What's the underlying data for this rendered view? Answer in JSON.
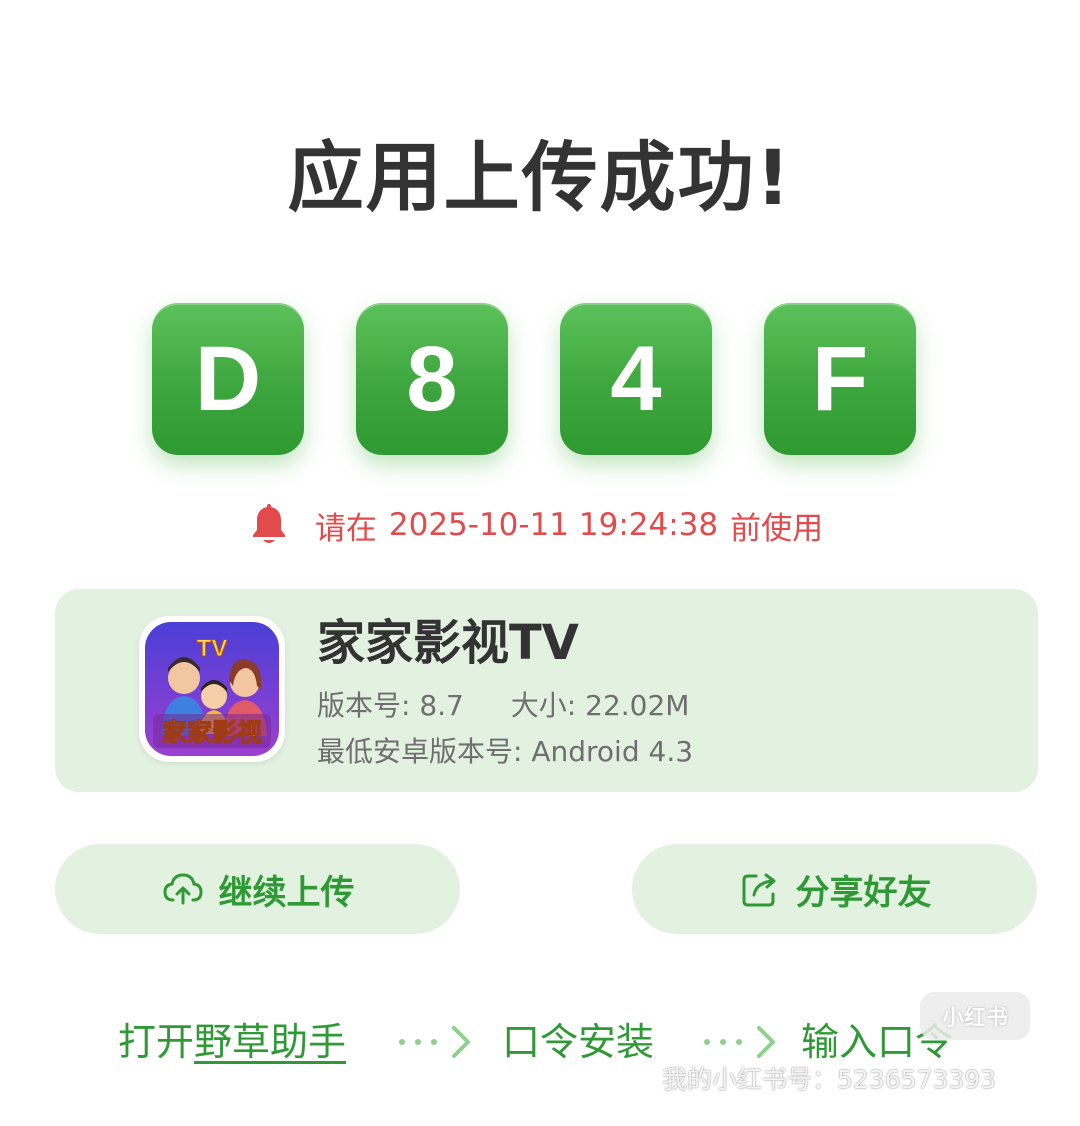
{
  "title": "应用上传成功!",
  "code": [
    "D",
    "8",
    "4",
    "F"
  ],
  "expire": {
    "prefix": "请在",
    "datetime": "2025-10-11 19:24:38",
    "suffix": "前使用"
  },
  "app": {
    "icon_text_top": "TV",
    "icon_text_bottom": "家家影视",
    "name": "家家影视TV",
    "version_label": "版本号:",
    "version": "8.7",
    "size_label": "大小:",
    "size": "22.02M",
    "min_android_label": "最低安卓版本号:",
    "min_android": "Android 4.3"
  },
  "buttons": {
    "continue_upload": "继续上传",
    "share_friends": "分享好友"
  },
  "steps": {
    "step1_prefix": "打开",
    "step1_highlight": "野草助手",
    "step2": "口令安装",
    "step3": "输入口令"
  },
  "watermark": {
    "badge": "小红书",
    "text": "我的小红书号：5236573393"
  },
  "colors": {
    "accent_green": "#3ea63e",
    "text_green": "#2f9a35",
    "warning_red": "#e24b4b",
    "card_bg": "#e3f1e1"
  }
}
